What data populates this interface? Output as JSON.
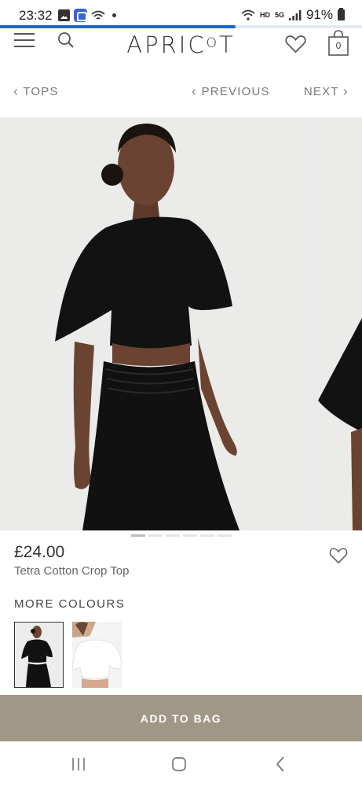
{
  "status_bar": {
    "time": "23:32",
    "network_label": "HD",
    "network_type": "5G",
    "battery": "91%",
    "icons": [
      "photo-icon",
      "app-icon",
      "wifi-icon",
      "signal-icon",
      "battery-icon"
    ]
  },
  "page_load_progress": 0.65,
  "header": {
    "logo": {
      "pre": "APRIC",
      "o": "O",
      "post": "T"
    },
    "bag_count": "0",
    "icons": [
      "menu-icon",
      "search-icon",
      "heart-icon",
      "bag-icon"
    ]
  },
  "nav": {
    "back_label": "TOPS",
    "previous_label": "PREVIOUS",
    "next_label": "NEXT"
  },
  "gallery": {
    "slide_count": 6,
    "active_index": 0
  },
  "product": {
    "price": "£24.00",
    "name": "Tetra Cotton Crop Top",
    "more_colours_label": "MORE COLOURS",
    "colours": [
      "black",
      "white"
    ]
  },
  "cta": {
    "add_to_bag_label": "ADD TO BAG",
    "color": "#a19786"
  },
  "colors": {
    "accent": "#1f63d0",
    "text": "#333333"
  }
}
